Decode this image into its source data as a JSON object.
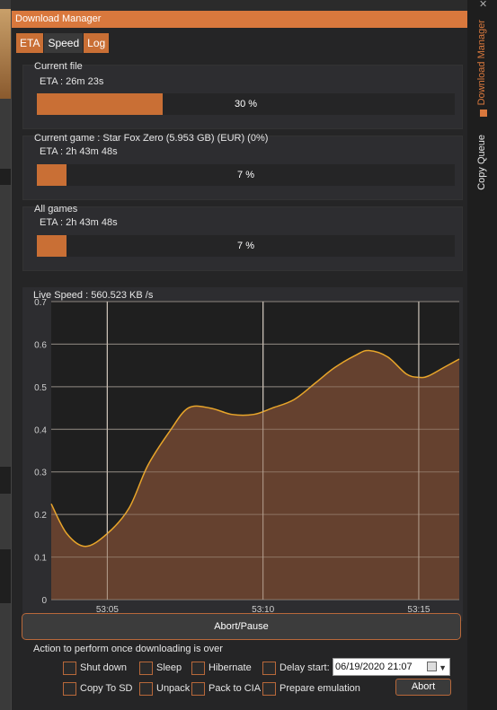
{
  "window": {
    "title": "Download Manager"
  },
  "tabs": [
    {
      "label": "ETA",
      "active": true
    },
    {
      "label": "Speed",
      "active": false
    },
    {
      "label": "Log",
      "active": false
    }
  ],
  "current_file": {
    "title": "Current file",
    "eta": "ETA : 26m 23s",
    "progress": 30,
    "progress_label": "30 %"
  },
  "current_game": {
    "title": "Current game : Star Fox Zero (5.953 GB) (EUR) (0%)",
    "eta": "ETA : 2h 43m 48s",
    "progress": 7,
    "progress_label": "7 %"
  },
  "all_games": {
    "title": "All games",
    "eta": "ETA : 2h 43m 48s",
    "progress": 7,
    "progress_label": "7 %"
  },
  "speed_chart": {
    "title": "Live Speed : 560.523 KB /s"
  },
  "sidebar": {
    "download_manager": "Download Manager",
    "copy_queue": "Copy Queue",
    "close": "✕"
  },
  "controls": {
    "abort_pause": "Abort/Pause",
    "action_title": "Action to perform once downloading is over",
    "shut_down": "Shut down",
    "sleep": "Sleep",
    "hibernate": "Hibernate",
    "delay_start": "Delay start:",
    "delay_value": "06/19/2020 21:07",
    "copy_to_sd": "Copy To SD",
    "unpack": "Unpack",
    "pack_to_cia": "Pack to CIA",
    "prepare_emulation": "Prepare emulation",
    "abort": "Abort"
  },
  "colors": {
    "accent": "#d9783d",
    "fill": "#6b4431",
    "line": "#e8a52a"
  },
  "chart_data": {
    "type": "area",
    "title": "",
    "xlabel": "",
    "ylabel": "",
    "ylim": [
      0,
      0.7
    ],
    "yticks": [
      "0",
      "0.1",
      "0.2",
      "0.3",
      "0.4",
      "0.5",
      "0.6",
      "0.7"
    ],
    "xtick_labels": [
      "53:05",
      "53:10",
      "53:15"
    ],
    "xlim_seconds": [
      3.2,
      16.3
    ],
    "xtick_seconds": [
      5,
      10,
      15
    ],
    "grid": true,
    "series": [
      {
        "x": [
          3.2,
          3.7,
          4.3,
          5.0,
          5.7,
          6.3,
          7.0,
          7.6,
          8.3,
          9.0,
          9.7,
          10.3,
          11.0,
          11.7,
          12.3,
          13.0,
          13.4,
          14.0,
          14.6,
          15.0,
          15.3,
          15.8,
          16.3
        ],
        "y": [
          0.225,
          0.155,
          0.125,
          0.155,
          0.215,
          0.315,
          0.395,
          0.45,
          0.45,
          0.435,
          0.435,
          0.45,
          0.47,
          0.51,
          0.545,
          0.575,
          0.585,
          0.57,
          0.53,
          0.522,
          0.525,
          0.545,
          0.565
        ]
      }
    ]
  }
}
